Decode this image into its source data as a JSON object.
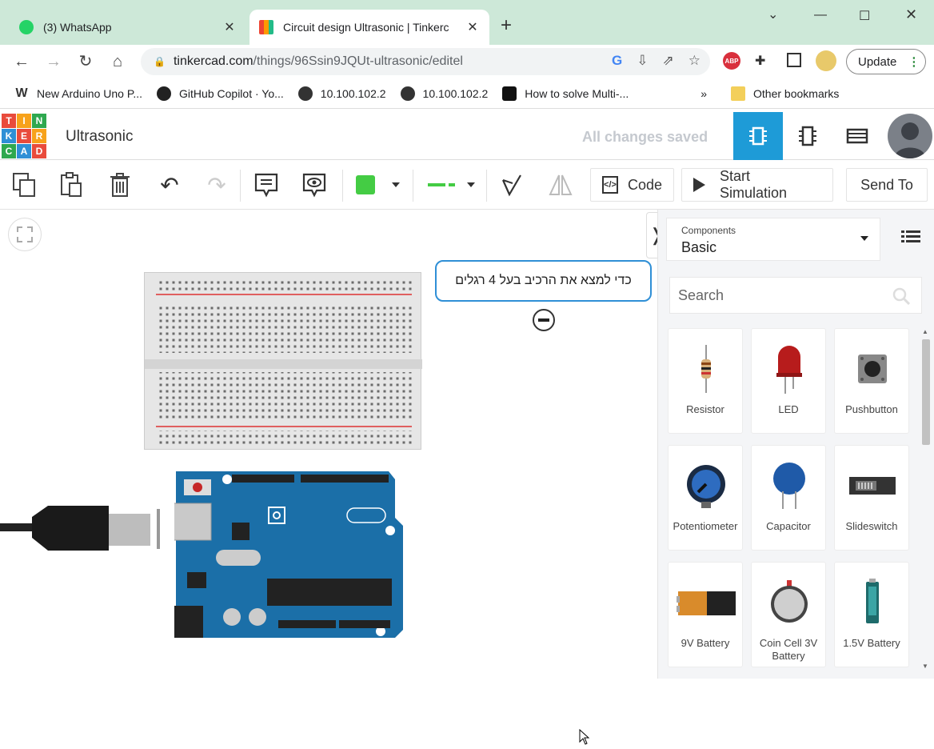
{
  "browser": {
    "tabs": [
      {
        "title": "(3) WhatsApp",
        "active": false
      },
      {
        "title": "Circuit design Ultrasonic | Tinkerc",
        "active": true
      }
    ],
    "url_host": "tinkercad.com",
    "url_path": "/things/96Ssin9JQUt-ultrasonic/editel",
    "update_label": "Update",
    "bookmarks": [
      {
        "label": "New Arduino Uno P..."
      },
      {
        "label": "GitHub Copilot · Yo..."
      },
      {
        "label": "10.100.102.2"
      },
      {
        "label": "10.100.102.2"
      },
      {
        "label": "How to solve Multi-..."
      }
    ],
    "more_bookmarks": "»",
    "other_bookmarks": "Other bookmarks"
  },
  "header": {
    "logo_letters": [
      "TIN",
      "KER",
      "CAD"
    ],
    "project_title": "Ultrasonic",
    "save_status": "All changes saved"
  },
  "toolbar": {
    "code_label": "Code",
    "start_sim_label": "Start Simulation",
    "send_to_label": "Send To",
    "wire_color": "#44cc44"
  },
  "canvas": {
    "note_text": "כדי למצא את הרכיב בעל 4 רגלים"
  },
  "panel": {
    "components_label": "Components",
    "components_value": "Basic",
    "search_placeholder": "Search",
    "items": [
      {
        "name": "Resistor"
      },
      {
        "name": "LED"
      },
      {
        "name": "Pushbutton"
      },
      {
        "name": "Potentiometer"
      },
      {
        "name": "Capacitor"
      },
      {
        "name": "Slideswitch"
      },
      {
        "name": "9V Battery"
      },
      {
        "name": "Coin Cell 3V Battery"
      },
      {
        "name": "1.5V Battery"
      }
    ]
  },
  "colors": {
    "tinkercad_blue": "#1e9bd7",
    "arduino_board": "#1b6fa8",
    "note_border": "#2f8fd6"
  }
}
